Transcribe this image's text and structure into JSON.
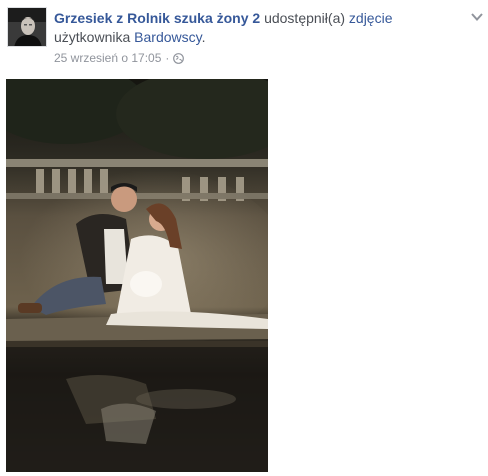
{
  "post": {
    "author": "Grzesiek z Rolnik szuka żony 2",
    "action_prefix": "udostępnił(a)",
    "action_link": "zdjęcie",
    "owner_prefix": "użytkownika",
    "owner": "Bardowscy",
    "owner_suffix": ".",
    "timestamp": "25 wrzesień o 17:05",
    "separator": "·",
    "privacy_icon": "globe-icon",
    "menu_icon": "chevron-down-icon",
    "photo_icon": "couple-on-bridge-photo"
  },
  "colors": {
    "link": "#365899",
    "text": "#4b4f56",
    "meta": "#90949c"
  }
}
